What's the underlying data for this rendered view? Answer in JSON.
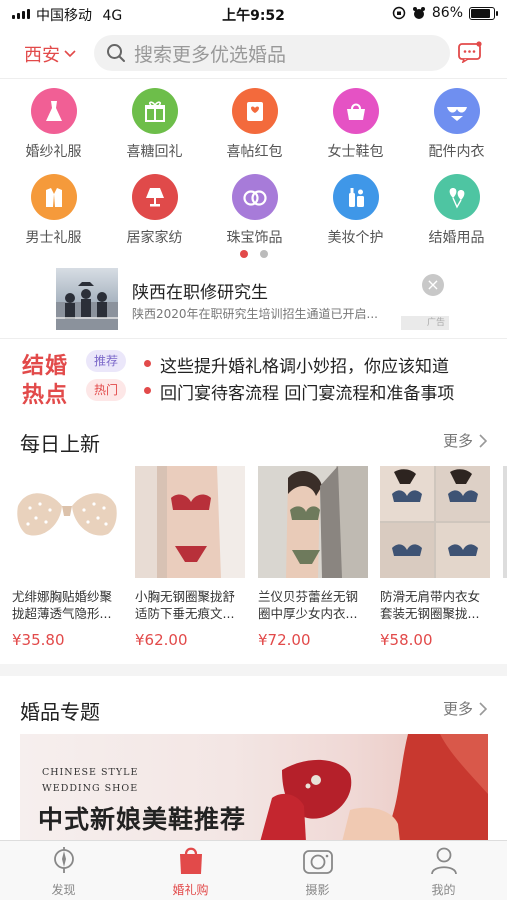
{
  "status_bar": {
    "carrier": "中国移动",
    "network": "4G",
    "time": "上午9:52",
    "battery": "86%",
    "battery_level": 0.86
  },
  "header": {
    "city": "西安",
    "search_placeholder": "搜索更多优选婚品"
  },
  "categories": [
    {
      "label": "婚纱礼服",
      "icon": "dress-icon",
      "color": "#f15f95"
    },
    {
      "label": "喜糖回礼",
      "icon": "gift-icon",
      "color": "#6dbe4a"
    },
    {
      "label": "喜帖红包",
      "icon": "envelope-icon",
      "color": "#f36a3c"
    },
    {
      "label": "女士鞋包",
      "icon": "handbag-icon",
      "color": "#e552c4"
    },
    {
      "label": "配件内衣",
      "icon": "lingerie-icon",
      "color": "#6f8ff0"
    },
    {
      "label": "男士礼服",
      "icon": "suit-icon",
      "color": "#f59a3b"
    },
    {
      "label": "居家家纺",
      "icon": "lamp-icon",
      "color": "#e04a4a"
    },
    {
      "label": "珠宝饰品",
      "icon": "rings-icon",
      "color": "#a77bd9"
    },
    {
      "label": "美妆个护",
      "icon": "cosmetics-icon",
      "color": "#3f97e8"
    },
    {
      "label": "结婚用品",
      "icon": "balloon-icon",
      "color": "#4ec5a2"
    }
  ],
  "ad": {
    "title": "陕西在职修研究生",
    "desc": "陕西2020年在职研究生培训招生通道已开启...",
    "tag": "广告"
  },
  "hot": {
    "title_line1": "结婚",
    "title_line2": "热点",
    "items": [
      {
        "tag": "推荐",
        "text": "这些提升婚礼格调小妙招，你应该知道"
      },
      {
        "tag": "热门",
        "text": "回门宴待客流程 回门宴流程和准备事项"
      }
    ]
  },
  "daily_new": {
    "title": "每日上新",
    "more": "更多",
    "products": [
      {
        "name": "尤绯娜胸贴婚纱聚拢超薄透气隐形...",
        "price": "¥35.80"
      },
      {
        "name": "小胸无钢圈聚拢舒适防下垂无痕文...",
        "price": "¥62.00"
      },
      {
        "name": "兰仪贝芬蕾丝无钢圈中厚少女内衣...",
        "price": "¥72.00"
      },
      {
        "name": "防滑无肩带内衣女套装无钢圈聚拢...",
        "price": "¥58.00"
      }
    ]
  },
  "topics": {
    "title": "婚品专题",
    "more": "更多",
    "banner": {
      "en_line1": "CHINESE STYLE",
      "en_line2": "WEDDING SHOE",
      "cn_title": "中式新娘美鞋推荐"
    }
  },
  "tabbar": [
    {
      "label": "发现",
      "icon": "discover-icon",
      "active": false
    },
    {
      "label": "婚礼购",
      "icon": "shopping-bag-icon",
      "active": true
    },
    {
      "label": "摄影",
      "icon": "camera-icon",
      "active": false
    },
    {
      "label": "我的",
      "icon": "user-icon",
      "active": false
    }
  ],
  "colors": {
    "accent": "#e24a4a",
    "text": "#222222",
    "muted": "#888888"
  }
}
